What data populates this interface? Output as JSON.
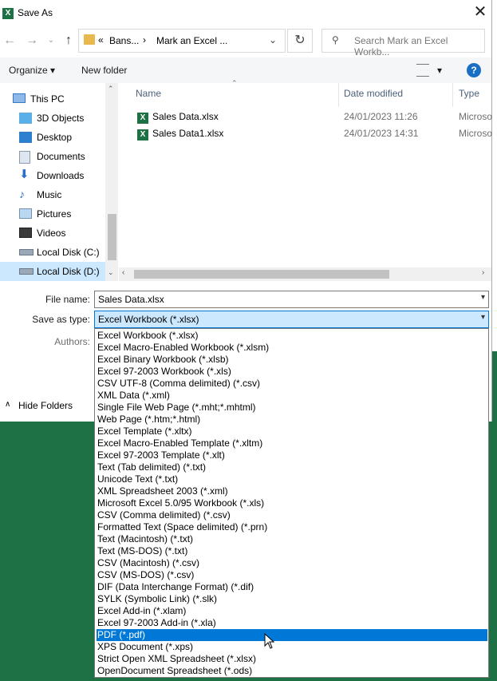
{
  "window": {
    "title": "Save As",
    "close_label": "✕"
  },
  "address": {
    "chevrons": "«",
    "crumb1": "Bans...",
    "sep": "›",
    "crumb2": "Mark an Excel ...",
    "search_placeholder": "Search Mark an Excel Workb..."
  },
  "toolbar": {
    "organize": "Organize ▾",
    "new_folder": "New folder",
    "view_arrow": "▾",
    "help": "?"
  },
  "nav": {
    "items": [
      {
        "label": "This PC",
        "icon": "computer-icon"
      },
      {
        "label": "3D Objects",
        "icon": "cube-icon"
      },
      {
        "label": "Desktop",
        "icon": "desktop-icon"
      },
      {
        "label": "Documents",
        "icon": "document-icon"
      },
      {
        "label": "Downloads",
        "icon": "download-icon"
      },
      {
        "label": "Music",
        "icon": "music-icon"
      },
      {
        "label": "Pictures",
        "icon": "pictures-icon"
      },
      {
        "label": "Videos",
        "icon": "videos-icon"
      },
      {
        "label": "Local Disk (C:)",
        "icon": "drive-icon"
      },
      {
        "label": "Local Disk (D:)",
        "icon": "drive-icon"
      }
    ]
  },
  "files": {
    "headers": {
      "name": "Name",
      "date": "Date modified",
      "type": "Type"
    },
    "rows": [
      {
        "name": "Sales Data.xlsx",
        "date": "24/01/2023 11:26",
        "type": "Microso"
      },
      {
        "name": "Sales Data1.xlsx",
        "date": "24/01/2023 14:31",
        "type": "Microso"
      }
    ]
  },
  "form": {
    "file_name_label": "File name:",
    "file_name_value": "Sales Data.xlsx",
    "save_type_label": "Save as type:",
    "save_type_value": "Excel Workbook (*.xlsx)",
    "authors_label": "Authors:",
    "hide_folders": "Hide Folders"
  },
  "dropdown": {
    "selected_index": 25,
    "options": [
      "Excel Workbook (*.xlsx)",
      "Excel Macro-Enabled Workbook (*.xlsm)",
      "Excel Binary Workbook (*.xlsb)",
      "Excel 97-2003 Workbook (*.xls)",
      "CSV UTF-8 (Comma delimited) (*.csv)",
      "XML Data (*.xml)",
      "Single File Web Page (*.mht;*.mhtml)",
      "Web Page (*.htm;*.html)",
      "Excel Template (*.xltx)",
      "Excel Macro-Enabled Template (*.xltm)",
      "Excel 97-2003 Template (*.xlt)",
      "Text (Tab delimited) (*.txt)",
      "Unicode Text (*.txt)",
      "XML Spreadsheet 2003 (*.xml)",
      "Microsoft Excel 5.0/95 Workbook (*.xls)",
      "CSV (Comma delimited) (*.csv)",
      "Formatted Text (Space delimited) (*.prn)",
      "Text (Macintosh) (*.txt)",
      "Text (MS-DOS) (*.txt)",
      "CSV (Macintosh) (*.csv)",
      "CSV (MS-DOS) (*.csv)",
      "DIF (Data Interchange Format) (*.dif)",
      "SYLK (Symbolic Link) (*.slk)",
      "Excel Add-in (*.xlam)",
      "Excel 97-2003 Add-in (*.xla)",
      "PDF (*.pdf)",
      "XPS Document (*.xps)",
      "Strict Open XML Spreadsheet (*.xlsx)",
      "OpenDocument Spreadsheet (*.ods)"
    ]
  },
  "colors": {
    "accent": "#0078d7",
    "selection": "#cce8ff",
    "excel_green": "#1e7145"
  }
}
